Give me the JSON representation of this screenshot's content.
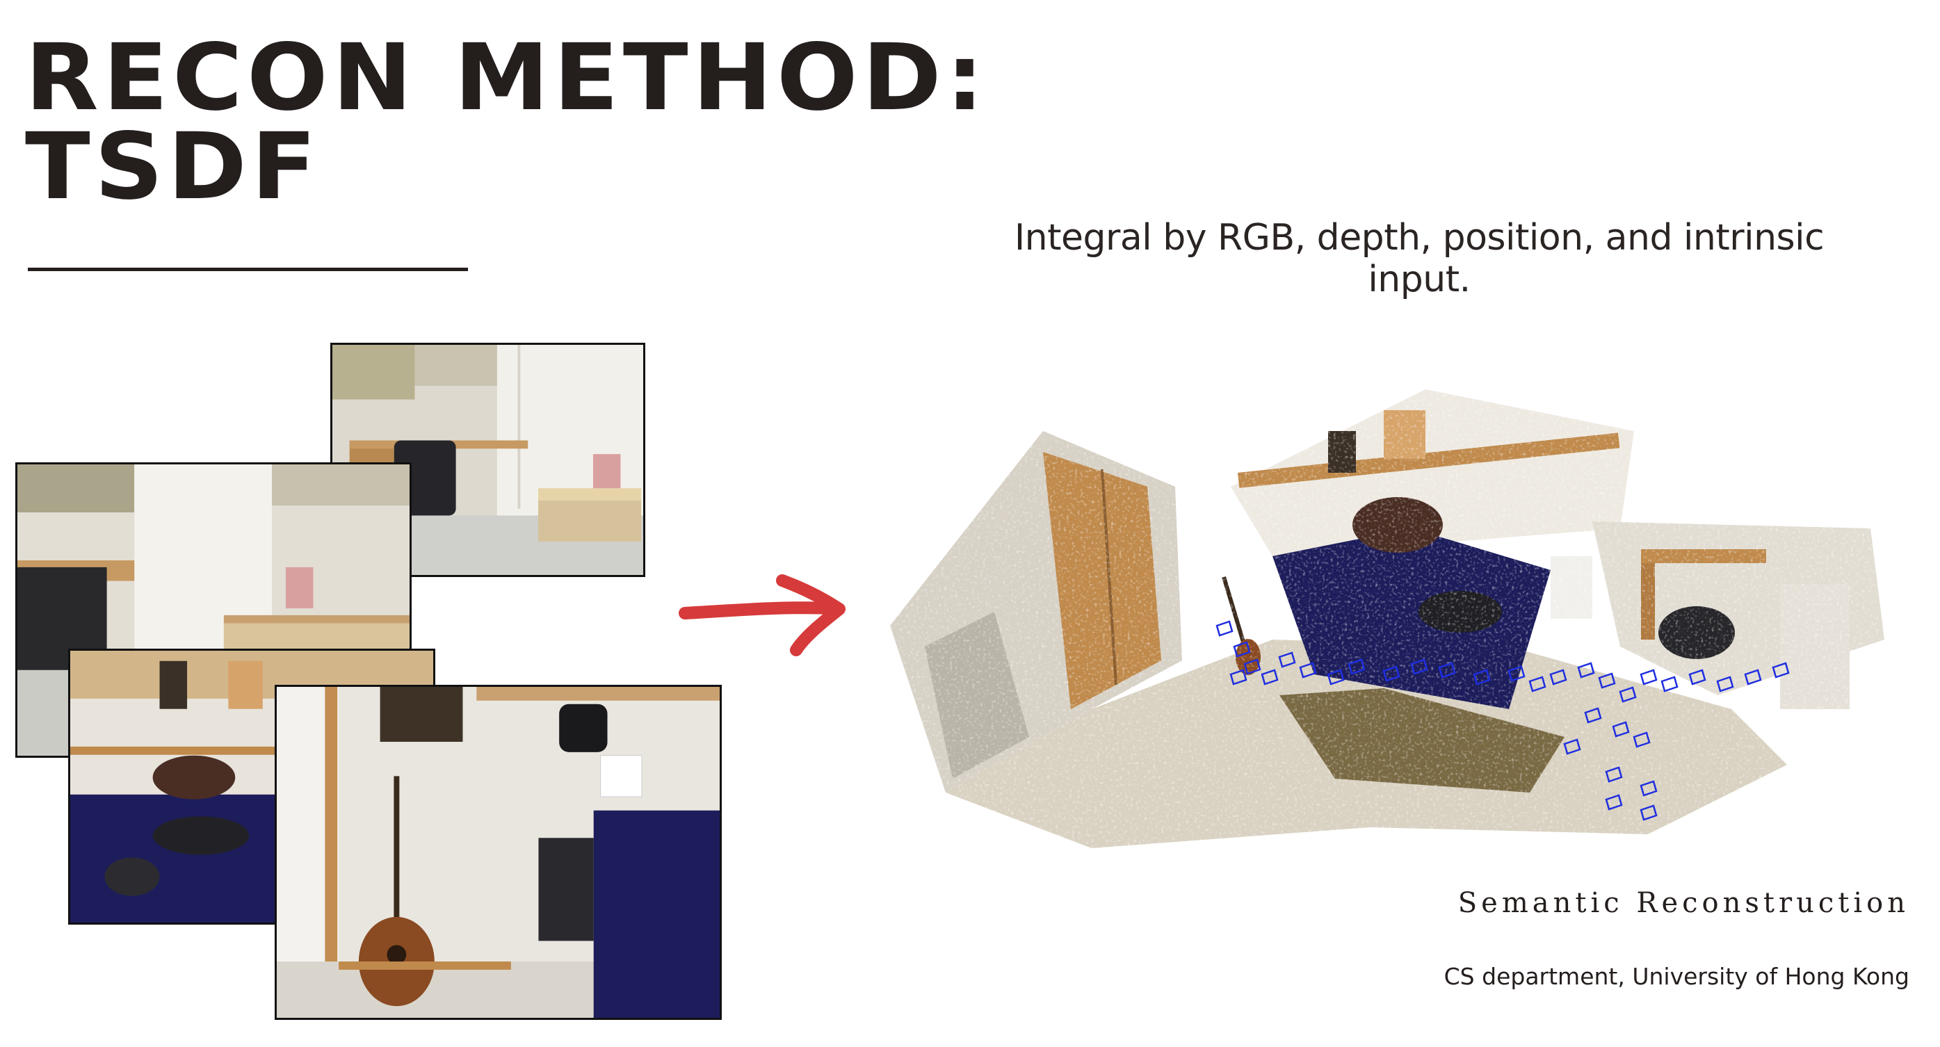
{
  "slide": {
    "title_line1": "RECON METHOD:",
    "title_line2": "TSDF",
    "subtitle": "Integral by RGB, depth, position, and intrinsic input.",
    "footer_title": "Semantic Reconstruction",
    "footer_org": "CS department, University of Hong Kong"
  },
  "colors": {
    "title": "#241e1d",
    "arrow": "#d63a3a",
    "camera_frustums": "#1f2fe0",
    "bed_cover": "#1d1d5c",
    "wood": "#c08a4c"
  }
}
